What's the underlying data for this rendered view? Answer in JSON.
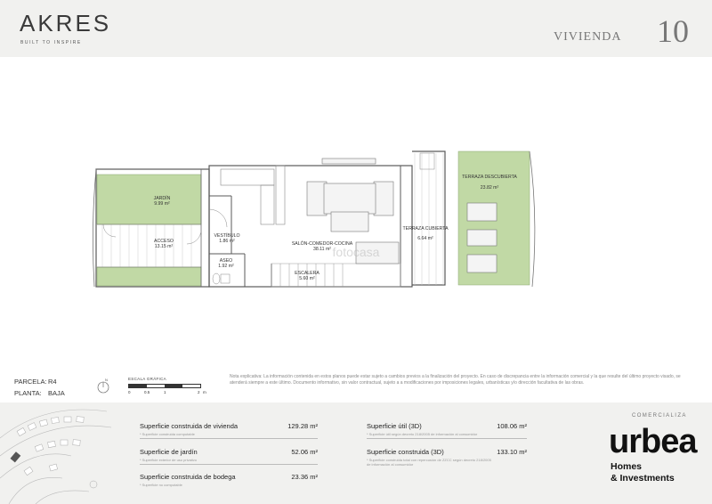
{
  "header": {
    "logo_text": "AKRES",
    "logo_tagline": "BUILT TO INSPIRE",
    "unit_label": "VIVIENDA",
    "unit_number": "10"
  },
  "plan": {
    "rooms": [
      {
        "name": "JARDÍN",
        "area": "9.99 m²"
      },
      {
        "name": "ACCESO",
        "area": "13.15 m²"
      },
      {
        "name": "VESTÍBULO",
        "area": "1.86 m²"
      },
      {
        "name": "ASEO",
        "area": "1.92 m²"
      },
      {
        "name": "SALÓN-COMEDOR-COCINA",
        "area": "38.11 m²"
      },
      {
        "name": "ESCALERA",
        "area": "5.60 m²"
      },
      {
        "name": "TERRAZA CUBIERTA",
        "area": "6.64 m²"
      },
      {
        "name": "TERRAZA DESCUBIERTA",
        "area": "23.82 m²"
      }
    ],
    "watermark": "fotocasa"
  },
  "info": {
    "parcela_label": "PARCELA:",
    "parcela_value": "R4",
    "planta_label": "PLANTA:",
    "planta_value": "BAJA",
    "compass_letter": "N",
    "scale_title": "ESCALA GRÁFICA",
    "scale_ticks": [
      "0",
      "0.5",
      "1",
      "2",
      "m"
    ],
    "note": "Nota explicativa: La información contenida en estos planos puede estar sujeto a cambios previos a la finalización del proyecto. En caso de discrepancia entre la información comercial y la que resulte del último proyecto visado, se atenderá siempre a este último. Documento informativo, sin valor contractual, sujeto a a modificaciones por imposiciones legales, urbanísticas y/o dirección facultativa de las obras."
  },
  "areas": {
    "left": [
      {
        "label": "Superficie construida de vivienda",
        "sub": "* Superficie construida computable",
        "value": "129.28 m²"
      },
      {
        "label": "Superficie de jardín",
        "sub": "* Superficie exterior de uso privativo",
        "value": "52.06 m²"
      },
      {
        "label": "Superficie construida de bodega",
        "sub": "* Superficie no computable",
        "value": "23.36 m²"
      }
    ],
    "right": [
      {
        "label": "Superficie útil (3D)",
        "sub": "* Superficie útil según decreto 218/2005 de información al consumidor",
        "value": "108.06 m²"
      },
      {
        "label": "Superficie construida (3D)",
        "sub": "* Superficie construida total con repercusión de ZZCC según decreto 218/2005 de información al consumidor",
        "value": "133.10 m²"
      }
    ]
  },
  "brand": {
    "comercializa": "COMERCIALIZA",
    "name": "urbea",
    "line1": "Homes",
    "line2": "& Investments"
  },
  "colors": {
    "garden": "#c1d9a5",
    "header_bg": "#f1f1ef",
    "plan_line": "#5a5a5a"
  }
}
